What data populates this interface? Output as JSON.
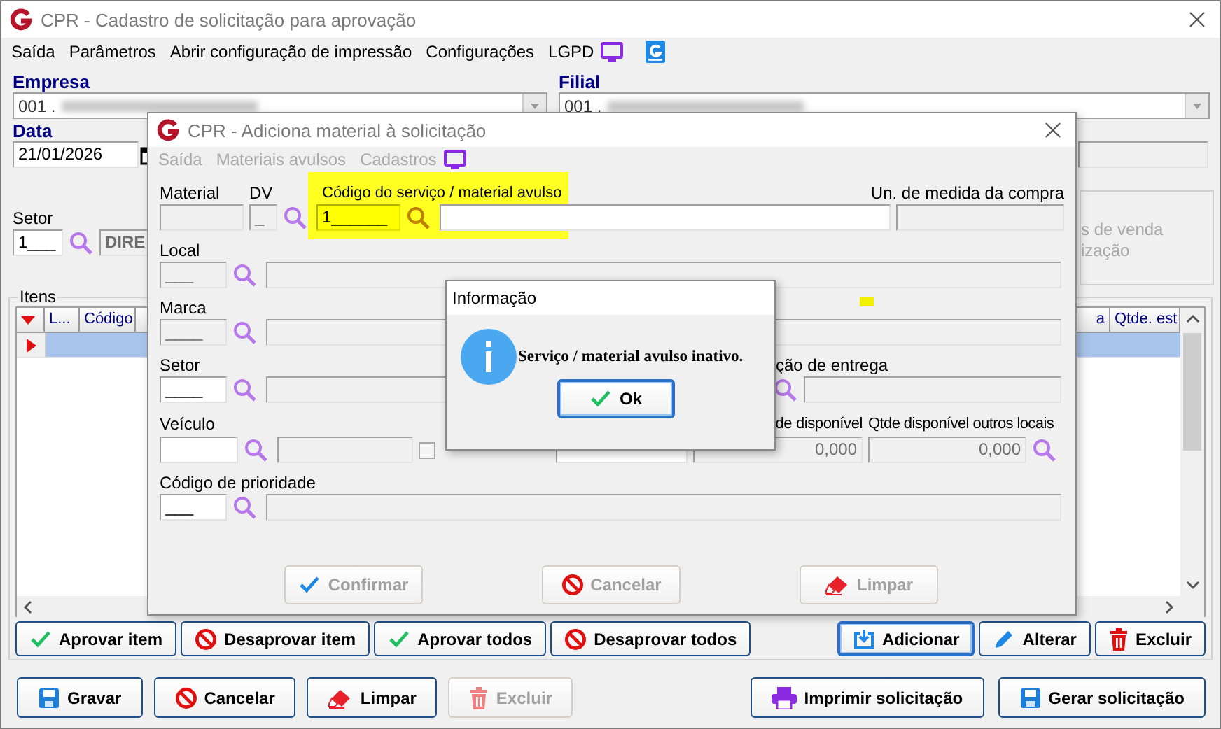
{
  "window": {
    "title": "CPR - Cadastro de solicitação para aprovação"
  },
  "menu": [
    {
      "label": "Saída"
    },
    {
      "label": "Parâmetros"
    },
    {
      "label": "Abrir configuração de impressão"
    },
    {
      "label": "Configurações"
    },
    {
      "label": "LGPD"
    }
  ],
  "empresa": {
    "label": "Empresa",
    "value": "001 ."
  },
  "filial": {
    "label": "Filial",
    "value": "001 ."
  },
  "data": {
    "label": "Data",
    "value": "21/01/2026"
  },
  "setor": {
    "label": "Setor",
    "code": "1___",
    "name": "DIRE"
  },
  "options_box": {
    "lines": [
      "s de venda",
      "ização"
    ]
  },
  "itens": {
    "title": "Itens",
    "columns": [
      "L...",
      "Código",
      "a",
      "Qtde. est"
    ],
    "rows": [
      {
        "selected": true
      }
    ]
  },
  "item_buttons": [
    {
      "label": "Aprovar item",
      "kind": "check",
      "disabled": false,
      "focused": false
    },
    {
      "label": "Desaprovar item",
      "kind": "block",
      "disabled": false,
      "focused": false
    },
    {
      "label": "Aprovar todos",
      "kind": "check",
      "disabled": false,
      "focused": false
    },
    {
      "label": "Desaprovar todos",
      "kind": "block",
      "disabled": false,
      "focused": false
    }
  ],
  "action_buttons": [
    {
      "label": "Adicionar",
      "kind": "import",
      "disabled": false,
      "focused": true
    },
    {
      "label": "Alterar",
      "kind": "pencil",
      "disabled": false,
      "focused": false
    },
    {
      "label": "Excluir",
      "kind": "trash",
      "disabled": false,
      "focused": false
    }
  ],
  "footer_left": [
    {
      "label": "Gravar",
      "kind": "disk",
      "disabled": false,
      "focused": false
    },
    {
      "label": "Cancelar",
      "kind": "block",
      "disabled": false,
      "focused": false
    },
    {
      "label": "Limpar",
      "kind": "eraser",
      "disabled": false,
      "focused": false
    },
    {
      "label": "Excluir",
      "kind": "trash",
      "disabled": true,
      "focused": false
    }
  ],
  "footer_right": [
    {
      "label": "Imprimir solicitação",
      "kind": "printer",
      "disabled": false,
      "focused": false
    },
    {
      "label": "Gerar solicitação",
      "kind": "disk",
      "disabled": false,
      "focused": false
    }
  ],
  "dialog": {
    "title": "CPR - Adiciona material à solicitação",
    "menu": [
      {
        "label": "Saída",
        "disabled": true
      },
      {
        "label": "Materiais avulsos",
        "disabled": true
      },
      {
        "label": "Cadastros",
        "disabled": true
      }
    ],
    "service": {
      "material_label": "Material",
      "material": {
        "disabled": true
      },
      "dv_label": "DV",
      "dv": {
        "value": "_",
        "disabled": true
      },
      "code_label": "Código do serviço / material avulso",
      "code": {
        "value": "1______",
        "disabled": false,
        "highlighted": true
      },
      "description": {
        "disabled": false
      },
      "unit_label": "Un. de medida da compra",
      "unit": {
        "disabled": true
      }
    },
    "lookups": [
      {
        "label": "Local",
        "code": {
          "value": "___",
          "disabled": true
        },
        "name": {
          "disabled": true
        }
      },
      {
        "label": "Marca",
        "code": {
          "value": "____",
          "disabled": true
        },
        "name": {
          "disabled": true
        }
      },
      {
        "label": "Setor",
        "code": {
          "value": "____",
          "disabled": false
        },
        "name": {
          "disabled": true
        },
        "extra_label": "ção de entrega",
        "extra": {
          "disabled": true
        }
      }
    ],
    "vehicle": {
      "label": "Veículo",
      "code": {
        "disabled": false
      },
      "name": {
        "disabled": true
      },
      "service_checked": false,
      "quantity": {
        "disabled": false
      },
      "available_label": "de disponível",
      "available": {
        "value": "0,000",
        "disabled": true
      },
      "other_label": "Qtde disponível outros locais",
      "other": {
        "value": "0,000",
        "disabled": true
      }
    },
    "priority": {
      "label": "Código de prioridade",
      "code": {
        "value": "___",
        "disabled": false
      },
      "name": {
        "disabled": true
      }
    },
    "buttons": [
      {
        "label": "Confirmar",
        "kind": "confirm",
        "disabled": true,
        "focused": false
      },
      {
        "label": "Cancelar",
        "kind": "block",
        "disabled": true,
        "focused": false
      },
      {
        "label": "Limpar",
        "kind": "eraser",
        "disabled": true,
        "focused": false
      }
    ]
  },
  "message": {
    "title": "Informação",
    "text": "Serviço / material avulso inativo.",
    "button": {
      "label": "Ok",
      "kind": "check",
      "disabled": false,
      "focused": true
    }
  }
}
